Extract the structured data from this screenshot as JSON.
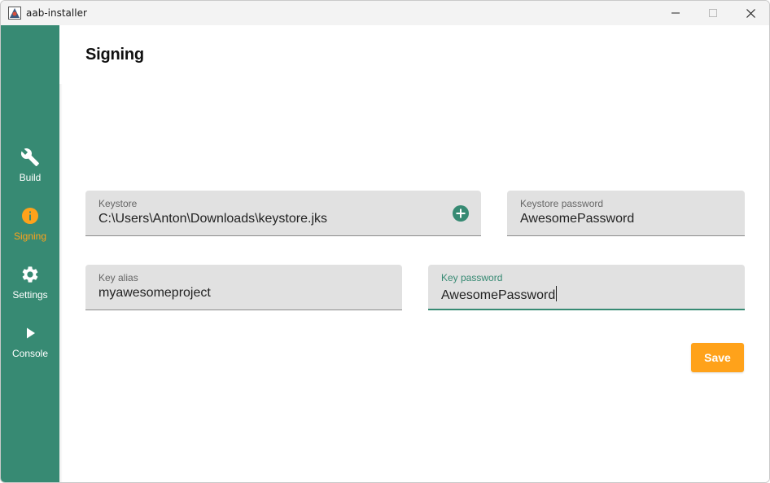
{
  "window": {
    "title": "aab-installer",
    "controls": [
      "minimize-icon",
      "maximize-icon",
      "close-icon"
    ]
  },
  "sidebar": {
    "items": [
      {
        "label": "Build",
        "icon": "wrench-icon",
        "active": false
      },
      {
        "label": "Signing",
        "icon": "info-icon",
        "active": true
      },
      {
        "label": "Settings",
        "icon": "gear-icon",
        "active": false
      },
      {
        "label": "Console",
        "icon": "play-icon",
        "active": false
      }
    ]
  },
  "main": {
    "title": "Signing",
    "fields": {
      "keystore": {
        "label": "Keystore",
        "value": "C:\\Users\\Anton\\Downloads\\keystore.jks",
        "action_icon": "add-circle-icon"
      },
      "keystore_password": {
        "label": "Keystore password",
        "value": "AwesomePassword"
      },
      "key_alias": {
        "label": "Key alias",
        "value": "myawesomeproject"
      },
      "key_password": {
        "label": "Key password",
        "value": "AwesomePassword",
        "focused": true
      }
    },
    "save_label": "Save"
  },
  "colors": {
    "sidebar_bg": "#378a73",
    "accent": "#ffa21a",
    "field_bg": "#e1e1e1",
    "focus": "#378a73"
  }
}
